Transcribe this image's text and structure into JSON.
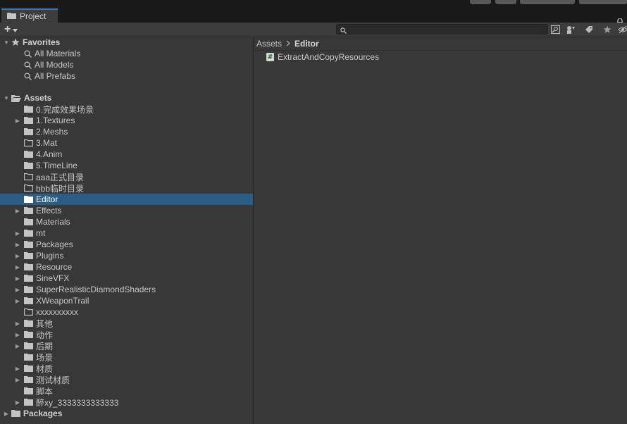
{
  "window": {
    "tab_title": "Project"
  },
  "toolbar": {
    "create_label": "+"
  },
  "search": {
    "value": ""
  },
  "favorites": {
    "title": "Favorites",
    "items": [
      {
        "label": "All Materials"
      },
      {
        "label": "All Models"
      },
      {
        "label": "All Prefabs"
      }
    ]
  },
  "assets": {
    "title": "Assets",
    "items": [
      {
        "label": "0.完成效果场景",
        "expandable": false,
        "empty": false
      },
      {
        "label": "1.Textures",
        "expandable": true,
        "empty": false
      },
      {
        "label": "2.Meshs",
        "expandable": false,
        "empty": false
      },
      {
        "label": "3.Mat",
        "expandable": false,
        "empty": true
      },
      {
        "label": "4.Anim",
        "expandable": false,
        "empty": false
      },
      {
        "label": "5.TimeLine",
        "expandable": false,
        "empty": false
      },
      {
        "label": "aaa正式目录",
        "expandable": false,
        "empty": true
      },
      {
        "label": "bbb临时目录",
        "expandable": false,
        "empty": true
      },
      {
        "label": "Editor",
        "expandable": false,
        "empty": false,
        "selected": true
      },
      {
        "label": "Effects",
        "expandable": true,
        "empty": false
      },
      {
        "label": "Materials",
        "expandable": false,
        "empty": false
      },
      {
        "label": "mt",
        "expandable": true,
        "empty": false
      },
      {
        "label": "Packages",
        "expandable": true,
        "empty": false
      },
      {
        "label": "Plugins",
        "expandable": true,
        "empty": false
      },
      {
        "label": "Resource",
        "expandable": true,
        "empty": false
      },
      {
        "label": "SineVFX",
        "expandable": true,
        "empty": false
      },
      {
        "label": "SuperRealisticDiamondShaders",
        "expandable": true,
        "empty": false
      },
      {
        "label": "XWeaponTrail",
        "expandable": true,
        "empty": false
      },
      {
        "label": "xxxxxxxxxx",
        "expandable": false,
        "empty": true
      },
      {
        "label": "其他",
        "expandable": true,
        "empty": false
      },
      {
        "label": "动作",
        "expandable": true,
        "empty": false
      },
      {
        "label": "后期",
        "expandable": true,
        "empty": false
      },
      {
        "label": "场景",
        "expandable": false,
        "empty": false
      },
      {
        "label": "材质",
        "expandable": true,
        "empty": false
      },
      {
        "label": "测试材质",
        "expandable": true,
        "empty": false
      },
      {
        "label": "脚本",
        "expandable": false,
        "empty": false
      },
      {
        "label": "醉xy_3333333333333",
        "expandable": true,
        "empty": false
      }
    ]
  },
  "packages": {
    "title": "Packages"
  },
  "breadcrumb": {
    "root": "Assets",
    "current": "Editor"
  },
  "contents": {
    "items": [
      {
        "label": "ExtractAndCopyResources",
        "type": "csharp-script"
      }
    ]
  },
  "colors": {
    "selection": "#2c5d87",
    "tab_accent": "#3a79bb",
    "background": "#383838"
  }
}
